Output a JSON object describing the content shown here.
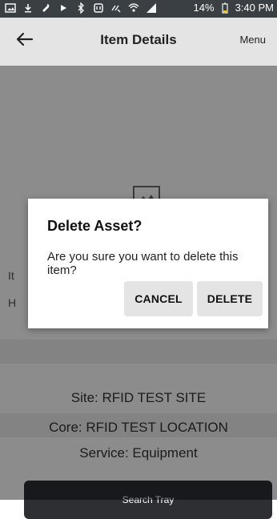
{
  "status_bar": {
    "battery_percent": "14%",
    "time": "3:40 PM",
    "icons": [
      "image-icon",
      "download-icon",
      "wrench-icon",
      "play-icon",
      "bluetooth-icon",
      "nfc-icon",
      "mute-icon",
      "wifi-icon",
      "signal-icon",
      "battery-icon"
    ]
  },
  "appbar": {
    "title": "Item Details",
    "menu_label": "Menu"
  },
  "content": {
    "label_1": "It",
    "label_2": "H",
    "site": "Site: RFID TEST SITE",
    "core": "Core: RFID TEST LOCATION",
    "service": "Service:  Equipment",
    "search_button": "Search Tray"
  },
  "dialog": {
    "title": "Delete Asset?",
    "message": "Are you sure you want to delete this item?",
    "cancel_label": "CANCEL",
    "delete_label": "DELETE"
  },
  "colors": {
    "status_bar": "#3a3f44",
    "appbar": "#e4e4e4",
    "button_dark": "#2d2f33",
    "dialog_button": "#e4e4e4"
  }
}
